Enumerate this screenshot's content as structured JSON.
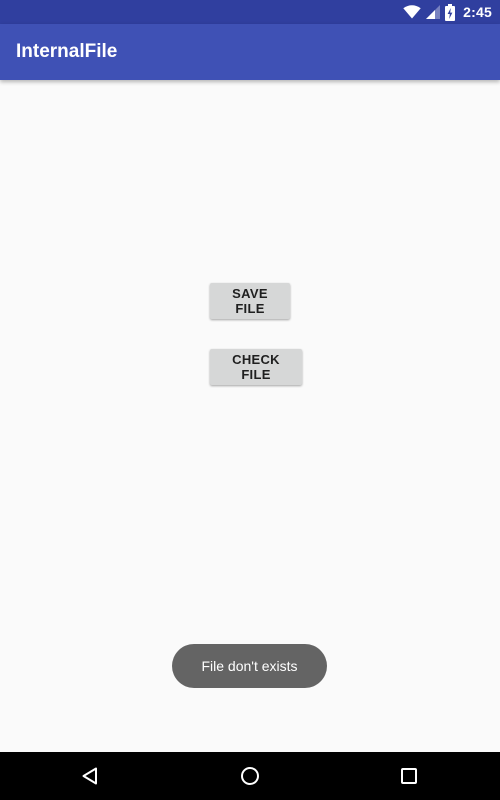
{
  "status_bar": {
    "time": "2:45",
    "icons": [
      "wifi-icon",
      "cellular-signal-icon",
      "battery-charging-icon"
    ]
  },
  "app_bar": {
    "title": "InternalFile",
    "color": "#3f51b5",
    "status_color": "#303f9f"
  },
  "buttons": {
    "save_label": "SAVE FILE",
    "check_label": "CHECK FILE"
  },
  "toast": {
    "message": "File don't exists"
  },
  "nav_bar": {
    "icons": [
      "back-icon",
      "home-icon",
      "recents-icon"
    ]
  }
}
